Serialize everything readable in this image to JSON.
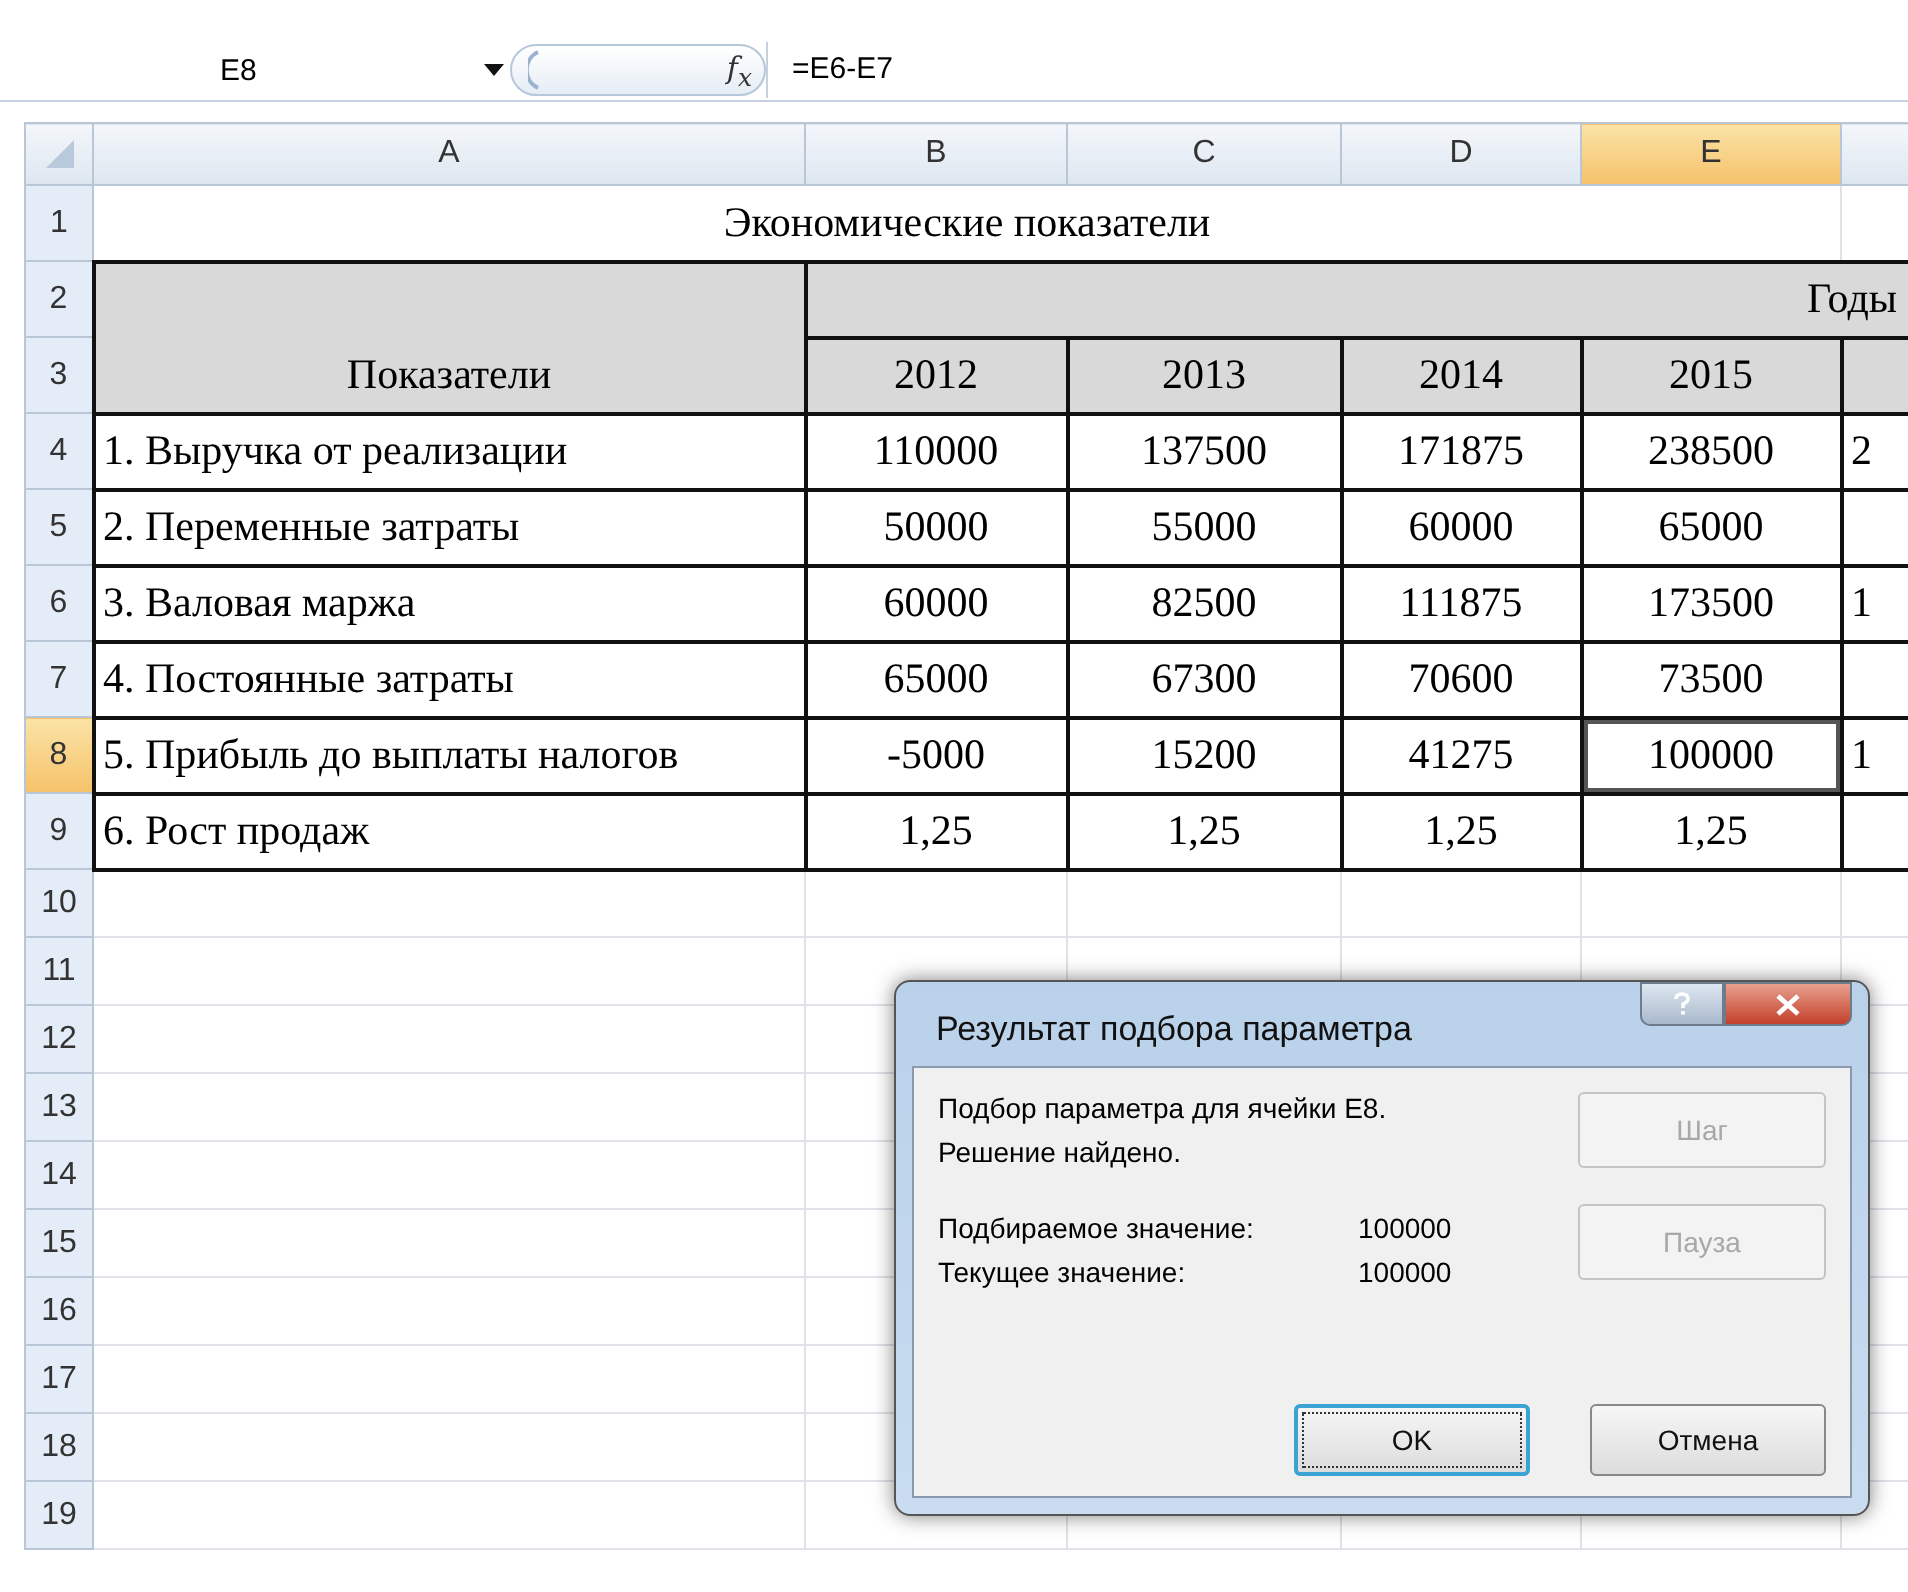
{
  "formula_bar": {
    "name_box": "E8",
    "function_label": "f$_{x}$",
    "formula": "=E6-E7"
  },
  "columns": [
    {
      "label": "A",
      "selected": false
    },
    {
      "label": "B",
      "selected": false
    },
    {
      "label": "C",
      "selected": false
    },
    {
      "label": "D",
      "selected": false
    },
    {
      "label": "E",
      "selected": true
    }
  ],
  "row_numbers": [
    {
      "label": "1",
      "selected": false
    },
    {
      "label": "2",
      "selected": false
    },
    {
      "label": "3",
      "selected": false
    },
    {
      "label": "4",
      "selected": false
    },
    {
      "label": "5",
      "selected": false
    },
    {
      "label": "6",
      "selected": false
    },
    {
      "label": "7",
      "selected": false
    },
    {
      "label": "8",
      "selected": true
    },
    {
      "label": "9",
      "selected": false
    },
    {
      "label": "10",
      "selected": false
    },
    {
      "label": "11",
      "selected": false
    },
    {
      "label": "12",
      "selected": false
    },
    {
      "label": "13",
      "selected": false
    },
    {
      "label": "14",
      "selected": false
    },
    {
      "label": "15",
      "selected": false
    },
    {
      "label": "16",
      "selected": false
    },
    {
      "label": "17",
      "selected": false
    },
    {
      "label": "18",
      "selected": false
    },
    {
      "label": "19",
      "selected": false
    }
  ],
  "sheet": {
    "title": "Экономические показатели",
    "years_label": "Годы",
    "header_label": "Показатели",
    "years": [
      "2012",
      "2013",
      "2014",
      "2015"
    ],
    "rows": [
      {
        "label": "1. Выручка от реализации",
        "cells": [
          {
            "text": "110000",
            "active": false
          },
          {
            "text": "137500",
            "active": false
          },
          {
            "text": "171875",
            "active": false
          },
          {
            "text": "238500",
            "active": false
          }
        ],
        "column_6": "2"
      },
      {
        "label": "2. Переменные  затраты",
        "cells": [
          {
            "text": "50000",
            "active": false
          },
          {
            "text": "55000",
            "active": false
          },
          {
            "text": "60000",
            "active": false
          },
          {
            "text": "65000",
            "active": false
          }
        ]
      },
      {
        "label": "3. Валовая маржа",
        "cells": [
          {
            "text": "60000",
            "active": false
          },
          {
            "text": "82500",
            "active": false
          },
          {
            "text": "111875",
            "active": false
          },
          {
            "text": "173500",
            "active": false
          }
        ],
        "column_6": "1"
      },
      {
        "label": "4. Постоянные затраты",
        "cells": [
          {
            "text": "65000",
            "active": false
          },
          {
            "text": "67300",
            "active": false
          },
          {
            "text": "70600",
            "active": false
          },
          {
            "text": "73500",
            "active": false
          }
        ]
      },
      {
        "label": "5. Прибыль до выплаты налогов",
        "cells": [
          {
            "text": "-5000",
            "active": false
          },
          {
            "text": "15200",
            "active": false
          },
          {
            "text": "41275",
            "active": false
          },
          {
            "text": "100000",
            "active": true
          }
        ],
        "column_6": "1"
      },
      {
        "label": "6. Рост продаж",
        "cells": [
          {
            "text": "1,25",
            "active": false
          },
          {
            "text": "1,25",
            "active": false
          },
          {
            "text": "1,25",
            "active": false
          },
          {
            "text": "1,25",
            "active": false
          }
        ]
      }
    ]
  },
  "dialog": {
    "title": "Результат подбора параметра",
    "message": [
      "Подбор параметра для ячейки E8.",
      "Решение найдено."
    ],
    "fields": [
      {
        "label": "Подбираемое значение:",
        "value": "100000"
      },
      {
        "label": "Текущее значение:",
        "value": "100000"
      }
    ],
    "side_buttons": [
      {
        "label": "Шаг",
        "disabled": true
      },
      {
        "label": "Пауза",
        "disabled": true
      }
    ],
    "buttons": [
      {
        "label": "OK",
        "default": true
      },
      {
        "label": "Отмена",
        "default": false
      }
    ]
  }
}
